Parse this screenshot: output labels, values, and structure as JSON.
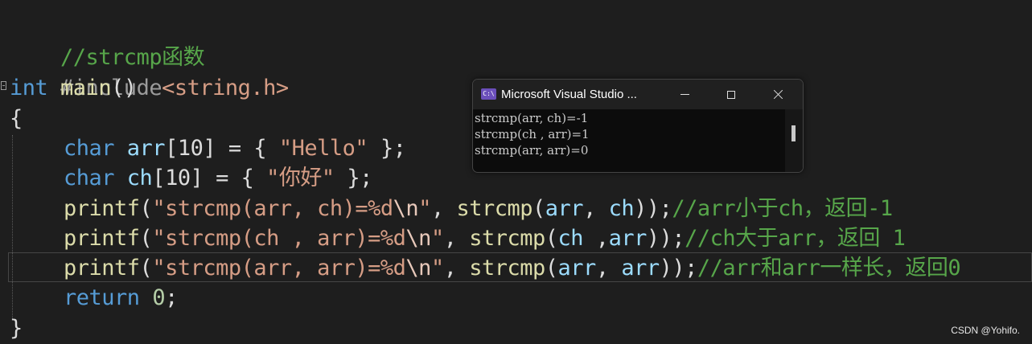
{
  "editor": {
    "line1": {
      "comment": "//strcmp函数"
    },
    "line2": {
      "directive": "#include",
      "header": "<string.h>"
    },
    "line3": {
      "kw_int": "int",
      "fn_main": "main",
      "parens": "()"
    },
    "line4": {
      "brace_open": "{"
    },
    "line5": {
      "kw_char": "char",
      "sp": " ",
      "var": "arr",
      "dims": "[10]",
      "eq": " = { ",
      "str": "\"Hello\"",
      "close": " };"
    },
    "line6": {
      "kw_char": "char",
      "sp": " ",
      "var": "ch",
      "dims": "[10]",
      "eq": " = { ",
      "str": "\"你好\"",
      "close": " };"
    },
    "line7": {
      "fn": "printf",
      "p1": "(",
      "str": "\"strcmp(arr, ch)=%d",
      "esc": "\\n",
      "str_end": "\"",
      "comma": ", ",
      "fn2": "strcmp",
      "p2": "(",
      "a": "arr",
      "sep": ", ",
      "b": "ch",
      "p3": "));",
      "comment": "//arr小于ch，返回-1"
    },
    "line8": {
      "fn": "printf",
      "p1": "(",
      "str": "\"strcmp(ch , arr)=%d",
      "esc": "\\n",
      "str_end": "\"",
      "comma": ", ",
      "fn2": "strcmp",
      "p2": "(",
      "a": "ch",
      "sep": " ,",
      "b": "arr",
      "p3": "));",
      "comment": "//ch大于arr，返回 1"
    },
    "line9": {
      "fn": "printf",
      "p1": "(",
      "str": "\"strcmp(arr, arr)=%d",
      "esc": "\\n",
      "str_end": "\"",
      "comma": ", ",
      "fn2": "strcmp",
      "p2": "(",
      "a": "arr",
      "sep": ", ",
      "b": "arr",
      "p3": "));",
      "comment": "//arr和arr一样长，返回0"
    },
    "line10": {
      "kw_return": "return",
      "sp": " ",
      "num": "0",
      "semi": ";"
    },
    "line11": {
      "brace_close": "}"
    }
  },
  "console": {
    "title": "Microsoft Visual Studio ...",
    "icon_label": "C:\\",
    "output": [
      "strcmp(arr, ch)=-1",
      "strcmp(ch , arr)=1",
      "strcmp(arr, arr)=0"
    ]
  },
  "watermark": "CSDN @Yohifo.",
  "colors": {
    "background": "#1e1e1e",
    "keyword": "#569cd6",
    "function": "#dcdcaa",
    "variable": "#9cdcfe",
    "string": "#d69d85",
    "comment": "#57a64a",
    "number": "#b5cea8",
    "console_bg": "#0c0c0c",
    "console_title_bg": "#202020"
  },
  "icons": [
    "console-app-icon",
    "minimize-icon",
    "maximize-icon",
    "close-icon"
  ]
}
